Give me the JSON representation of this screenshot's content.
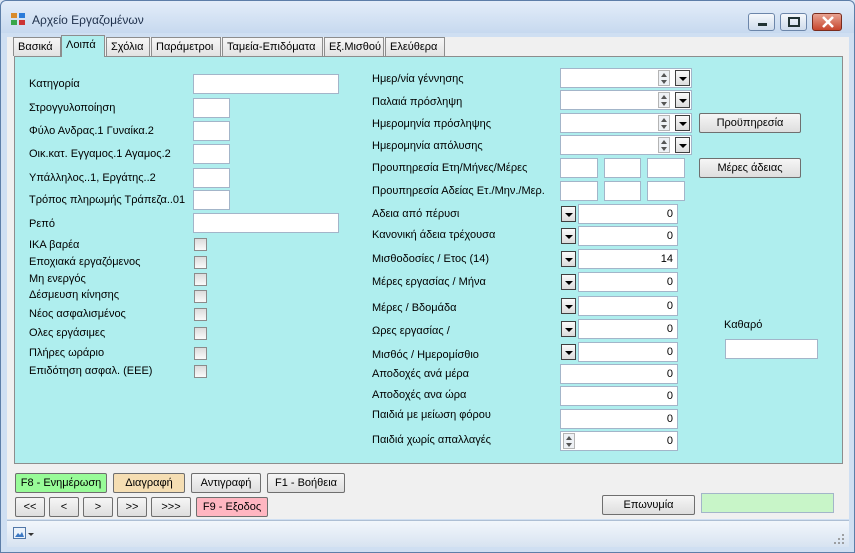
{
  "window": {
    "title": "Αρχείο Εργαζομένων"
  },
  "tabs": [
    "Βασικά",
    "Λοιπά",
    "Σχόλια",
    "Παράμετροι",
    "Ταμεία-Επιδόματα",
    "Εξ.Μισθού",
    "Ελεύθερα"
  ],
  "active_tab": "Λοιπά",
  "left": {
    "category": "Κατηγορία",
    "rounding": "Στρογγυλοποίηση",
    "gender": "Φύλο Ανδρας.1 Γυναίκα.2",
    "marital": "Οικ.κατ. Εγγαμος.1 Αγαμος.2",
    "emp_type": "Υπάλληλος..1, Εργάτης..2",
    "payment": "Τρόπος πληρωμής Τράπεζα..01",
    "repo": "Ρεπό",
    "checks": [
      "ΙΚΑ βαρέα",
      "Εποχιακά εργαζόμενος",
      "Μη ενεργός",
      "Δέσμευση κίνησης",
      "Νέος ασφαλισμένος",
      "Ολες εργάσιμες",
      "Πλήρες ωράριο",
      "Επιδότηση ασφαλ. (ΕΕΕ)"
    ]
  },
  "right": {
    "birth": "Ημερ/νία γέννησης",
    "old_hire": "Παλαιά πρόσληψη",
    "hire_date": "Ημερομηνία πρόσληψης",
    "fire_date": "Ημερομηνία απόλυσης",
    "prior_service": "Προυπηρεσία Ετη/Μήνες/Μέρες",
    "prior_leave": "Προυπηρεσία Αδείας Ετ./Μην./Μερ.",
    "leave_prev": "Αδεια από πέρυσι",
    "leave_cur": "Κανονική άδεια τρέχουσα",
    "salaries": "Μισθοδοσίες / Ετος (14)",
    "workdays_month": "Μέρες εργασίας / Μήνα",
    "days_week": "Μέρες / Βδομάδα",
    "hours": "Ωρες εργασίας /",
    "wage": "Μισθός / Ημερομίσθιο",
    "earn_day": "Αποδοχές ανά μέρα",
    "earn_hour": "Αποδοχές ανα ώρα",
    "kids_tax": "Παιδιά με μείωση φόρου",
    "kids_none": "Παιδιά χωρίς απαλλαγές",
    "values": {
      "leave_prev": "0",
      "leave_cur": "0",
      "salaries": "14",
      "workdays_month": "0",
      "days_week": "0",
      "hours": "0",
      "wage": "0",
      "earn_day": "0",
      "earn_hour": "0",
      "kids_tax": "0",
      "kids_none": "0"
    },
    "btn_prior": "Προϋπηρεσία",
    "btn_leave": "Μέρες άδειας",
    "net": "Καθαρό"
  },
  "bottom": {
    "update": "F8 - Ενημέρωση",
    "delete": "Διαγραφή",
    "copy": "Αντιγραφή",
    "help": "F1 - Βοήθεια",
    "nav": [
      "<<",
      "<",
      ">",
      ">>",
      ">>>"
    ],
    "exit": "F9 - Εξοδος",
    "company": "Επωνυμία"
  },
  "colors": {
    "panel": "#afeeee",
    "update": "#98fb98",
    "delete": "#f5deb3",
    "exit": "#ffb6c1",
    "company_field": "#c8f5c8"
  }
}
